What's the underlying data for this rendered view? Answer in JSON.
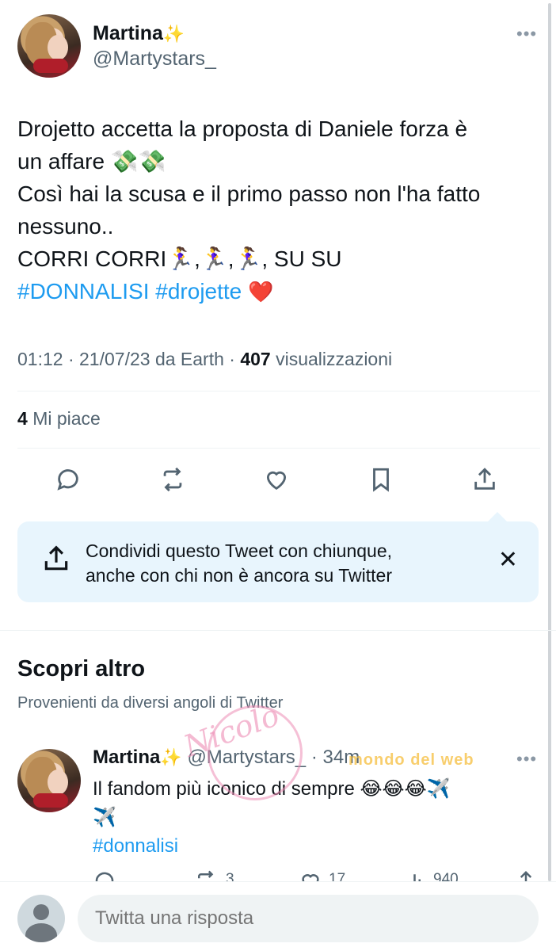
{
  "tweet": {
    "author_name": "Martina",
    "author_badge": "✨",
    "author_handle": "@Martystars_",
    "text_lines": [
      "Drojetto accetta la proposta di Daniele forza è",
      "un affare 💸💸",
      "Così hai la scusa e il primo passo non l'ha fatto",
      "nessuno..",
      "CORRI CORRI🏃‍♀️,🏃‍♀️,🏃‍♀️, SU SU"
    ],
    "hashtags": [
      "#DONNALISI",
      "#drojette"
    ],
    "hashtag_emoji": "❤️",
    "time": "01:12",
    "date": "21/07/23",
    "source": "da Earth",
    "views_count": "407",
    "views_label": "visualizzazioni",
    "likes_count": "4",
    "likes_label": "Mi piace"
  },
  "actions": {
    "reply_icon": "reply-icon",
    "retweet_icon": "retweet-icon",
    "like_icon": "heart-icon",
    "bookmark_icon": "bookmark-icon",
    "share_icon": "share-icon"
  },
  "share_prompt": {
    "line1": "Condividi questo Tweet con chiunque,",
    "line2": "anche con chi non è ancora su Twitter",
    "close": "✕"
  },
  "discover": {
    "title": "Scopri altro",
    "subtitle": "Provenienti da diversi angoli di Twitter"
  },
  "related_tweet": {
    "author_name": "Martina",
    "author_badge": "✨",
    "author_handle": "@Martystars_",
    "separator": "·",
    "age": "34m",
    "text": "Il fandom più iconico di sempre 😂😂😂✈️",
    "text_line2": "✈️",
    "hashtag": "#donnalisi",
    "retweets": "3",
    "likes": "17",
    "views": "940"
  },
  "reply_bar": {
    "placeholder": "Twitta una risposta"
  },
  "watermark": {
    "signature": "Nicolo",
    "site": "mondo del web"
  },
  "colors": {
    "text": "#0f1419",
    "secondary": "#536471",
    "accent": "#1d9bf0",
    "share_box": "#e8f5fd"
  }
}
